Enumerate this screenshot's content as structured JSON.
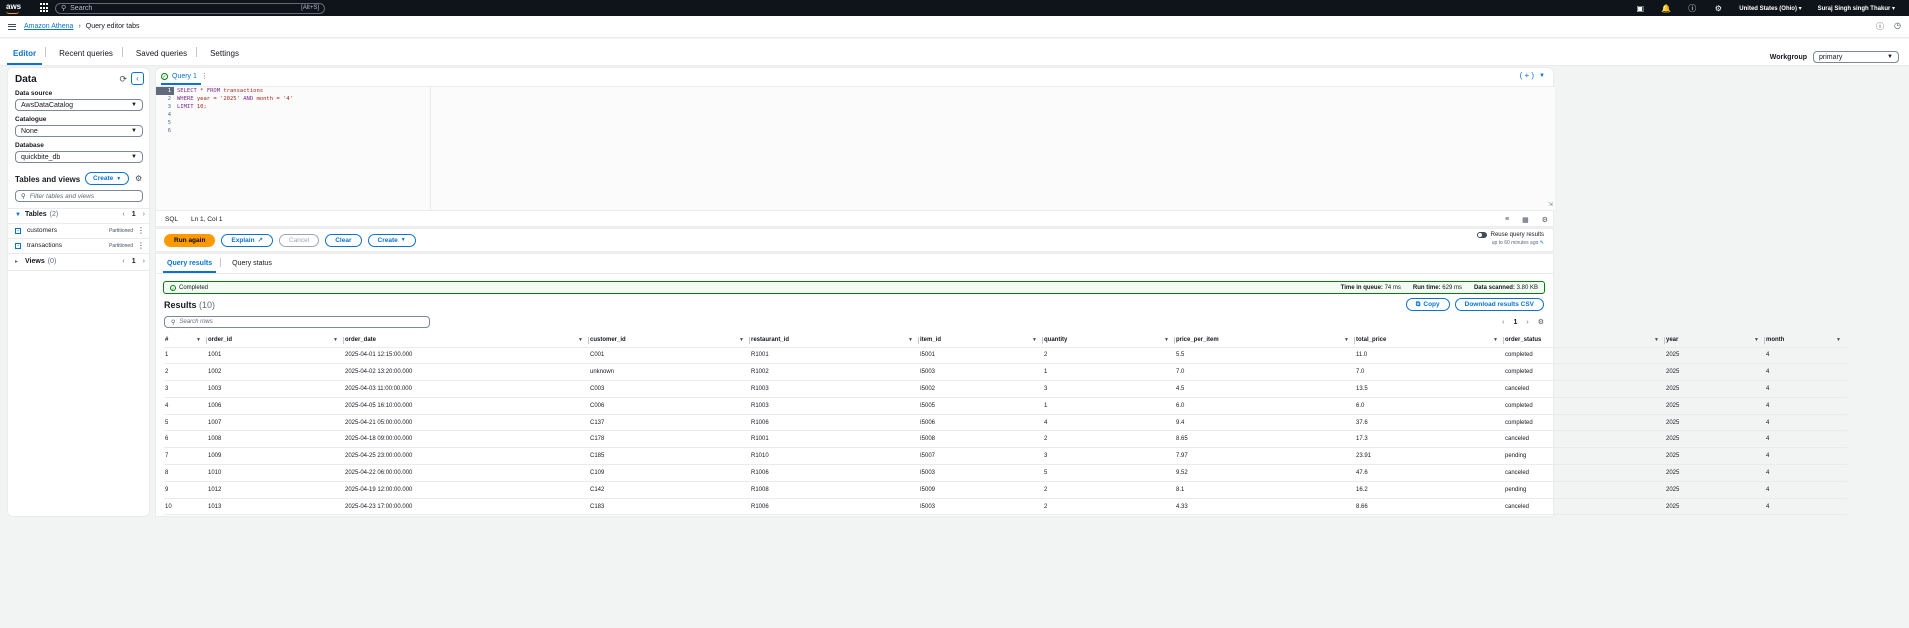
{
  "topnav": {
    "logo": "aws",
    "search_placeholder": "Search",
    "search_hint": "[Alt+S]",
    "region": "United States (Ohio) ▾",
    "user": "Suraj Singh singh Thakur ▾"
  },
  "breadcrumb": {
    "root": "Amazon Athena",
    "current": "Query editor tabs"
  },
  "main_tabs": [
    {
      "label": "Editor"
    },
    {
      "label": "Recent queries"
    },
    {
      "label": "Saved queries"
    },
    {
      "label": "Settings"
    }
  ],
  "workgroup": {
    "label": "Workgroup",
    "value": "primary"
  },
  "data_panel": {
    "title": "Data",
    "data_source_label": "Data source",
    "data_source_value": "AwsDataCatalog",
    "catalogue_label": "Catalogue",
    "catalogue_value": "None",
    "database_label": "Database",
    "database_value": "quickbite_db",
    "tables_views_title": "Tables and views",
    "create_label": "Create",
    "filter_placeholder": "Filter tables and views",
    "tables_group": {
      "name": "Tables",
      "count": "(2)",
      "page": "1"
    },
    "tables": [
      {
        "name": "customers",
        "badge": "Partitioned"
      },
      {
        "name": "transactions",
        "badge": "Partitioned"
      }
    ],
    "views_group": {
      "name": "Views",
      "count": "(0)",
      "page": "1"
    }
  },
  "editor": {
    "tab_name": "Query 1",
    "line_numbers": [
      "1",
      "2",
      "3",
      "4",
      "5",
      "6"
    ],
    "line1_kw1": "SELECT",
    "line1_rest": " * ",
    "line1_kw2": "FROM",
    "line1_table": " transactions",
    "line2_kw1": "WHERE",
    "line2_rest": " year = '2025' ",
    "line2_kw2": "AND",
    "line2_rest2": " month = '4'",
    "line3_kw": "LIMIT",
    "line3_rest": " 10;",
    "lang": "SQL",
    "cursor": "Ln 1, Col 1"
  },
  "actions": {
    "run": "Run again",
    "explain": "Explain",
    "cancel": "Cancel",
    "clear": "Clear",
    "create": "Create",
    "reuse_label": "Reuse query results",
    "reuse_sub": "up to 60 minutes ago"
  },
  "results_tabs": [
    {
      "label": "Query results"
    },
    {
      "label": "Query status"
    }
  ],
  "status": {
    "state": "Completed",
    "queue_label": "Time in queue:",
    "queue_value": "74 ms",
    "run_label": "Run time:",
    "run_value": "629 ms",
    "scanned_label": "Data scanned:",
    "scanned_value": "3.80 KB"
  },
  "results": {
    "title": "Results",
    "count": "(10)",
    "copy_label": "Copy",
    "download_label": "Download results CSV",
    "search_placeholder": "Search rows",
    "page": "1",
    "columns": [
      "#",
      "order_id",
      "order_date",
      "customer_id",
      "restaurant_id",
      "item_id",
      "quantity",
      "price_per_item",
      "total_price",
      "order_status",
      "year",
      "month"
    ],
    "rows": [
      [
        "1",
        "1001",
        "2025-04-01 12:15:00.000",
        "C001",
        "R1001",
        "I5001",
        "2",
        "5.5",
        "11.0",
        "completed",
        "2025",
        "4"
      ],
      [
        "2",
        "1002",
        "2025-04-02 13:20:00.000",
        "unknown",
        "R1002",
        "I5003",
        "1",
        "7.0",
        "7.0",
        "completed",
        "2025",
        "4"
      ],
      [
        "3",
        "1003",
        "2025-04-03 11:00:00.000",
        "C003",
        "R1003",
        "I5002",
        "3",
        "4.5",
        "13.5",
        "canceled",
        "2025",
        "4"
      ],
      [
        "4",
        "1006",
        "2025-04-05 16:10:00.000",
        "C006",
        "R1003",
        "I5005",
        "1",
        "6.0",
        "6.0",
        "completed",
        "2025",
        "4"
      ],
      [
        "5",
        "1007",
        "2025-04-21 05:00:00.000",
        "C137",
        "R1006",
        "I5006",
        "4",
        "9.4",
        "37.6",
        "completed",
        "2025",
        "4"
      ],
      [
        "6",
        "1008",
        "2025-04-18 09:00:00.000",
        "C178",
        "R1001",
        "I5008",
        "2",
        "8.65",
        "17.3",
        "canceled",
        "2025",
        "4"
      ],
      [
        "7",
        "1009",
        "2025-04-25 23:00:00.000",
        "C185",
        "R1010",
        "I5007",
        "3",
        "7.97",
        "23.91",
        "pending",
        "2025",
        "4"
      ],
      [
        "8",
        "1010",
        "2025-04-22 06:00:00.000",
        "C109",
        "R1006",
        "I5003",
        "5",
        "9.52",
        "47.6",
        "canceled",
        "2025",
        "4"
      ],
      [
        "9",
        "1012",
        "2025-04-19 12:00:00.000",
        "C142",
        "R1008",
        "I5009",
        "2",
        "8.1",
        "16.2",
        "pending",
        "2025",
        "4"
      ],
      [
        "10",
        "1013",
        "2025-04-23 17:00:00.000",
        "C183",
        "R1006",
        "I5003",
        "2",
        "4.33",
        "8.66",
        "canceled",
        "2025",
        "4"
      ]
    ]
  }
}
